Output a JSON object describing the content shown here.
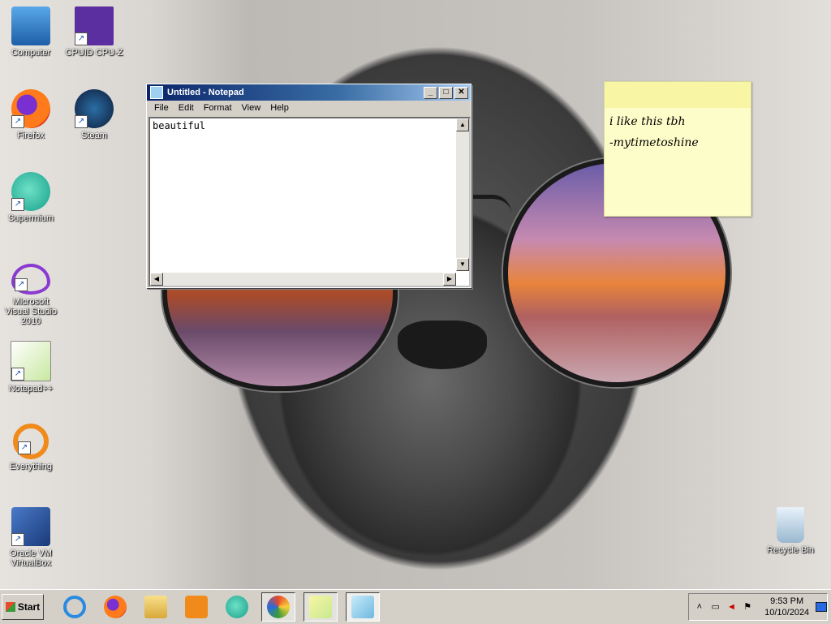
{
  "desktop": {
    "icons": [
      {
        "label": "Computer",
        "icon": "computer-icon"
      },
      {
        "label": "CPUID CPU-Z",
        "icon": "cpuz-icon"
      },
      {
        "label": "Firefox",
        "icon": "firefox-icon"
      },
      {
        "label": "Steam",
        "icon": "steam-icon"
      },
      {
        "label": "Supermium",
        "icon": "supermium-icon"
      },
      {
        "label": "Microsoft Visual Studio 2010",
        "icon": "visual-studio-icon"
      },
      {
        "label": "Notepad++",
        "icon": "notepadpp-icon"
      },
      {
        "label": "Everything",
        "icon": "everything-icon"
      },
      {
        "label": "Oracle VM VirtualBox",
        "icon": "virtualbox-icon"
      },
      {
        "label": "Recycle Bin",
        "icon": "recycle-bin-icon"
      }
    ]
  },
  "notepad": {
    "title": "Untitled - Notepad",
    "menu": [
      "File",
      "Edit",
      "Format",
      "View",
      "Help"
    ],
    "content": "beautiful",
    "buttons": {
      "minimize": "_",
      "maximize": "□",
      "close": "✕"
    }
  },
  "sticky": {
    "line1": "i like this tbh",
    "line2": "-mytimetoshine"
  },
  "taskbar": {
    "start_label": "Start",
    "apps": [
      "internet-explorer-icon",
      "firefox-icon",
      "file-explorer-icon",
      "media-player-icon",
      "supermium-icon",
      "paint-icon",
      "sticky-notes-icon",
      "notepad-icon"
    ],
    "clock": {
      "time": "9:53 PM",
      "date": "10/10/2024"
    }
  },
  "colors": {
    "titlebar": "#0a246a",
    "taskbar": "#d4d0c8",
    "sticky": "#fdfdc9"
  }
}
